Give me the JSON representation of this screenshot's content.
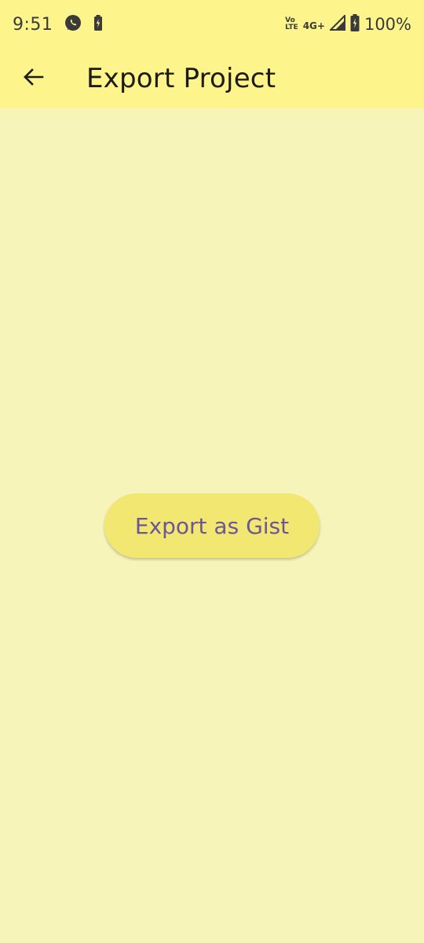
{
  "status_bar": {
    "time": "9:51",
    "volte_top": "Vo",
    "volte_bottom": "LTE",
    "network_type": "4G+",
    "battery_percent": "100%",
    "icons": [
      "whatsapp-icon",
      "battery-saver-icon",
      "signal-icon",
      "battery-icon"
    ]
  },
  "app_bar": {
    "back_icon": "arrow-back-icon",
    "title": "Export Project"
  },
  "main": {
    "export_gist_label": "Export as Gist"
  },
  "colors": {
    "app_bar_bg": "#fdf48b",
    "page_bg": "#f6f4b8",
    "button_bg": "#f2e770",
    "button_text": "#6d5697"
  }
}
